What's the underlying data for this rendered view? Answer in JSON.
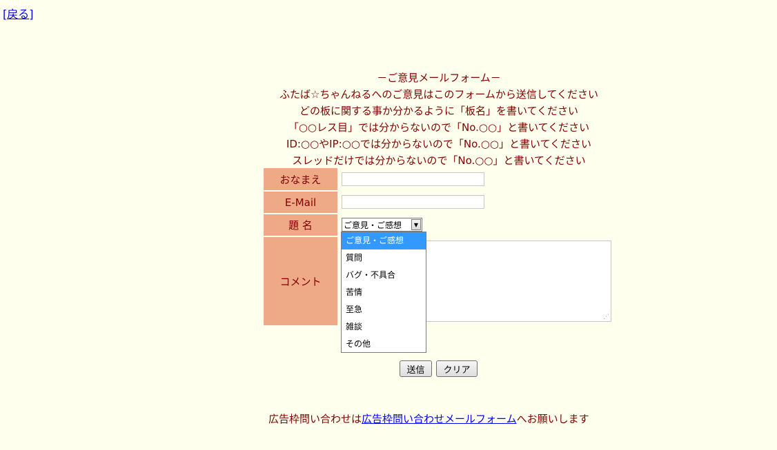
{
  "nav": {
    "back_open": "[",
    "back_label": "戻る",
    "back_close": "]"
  },
  "intro": {
    "title": "－ご意見メールフォーム－",
    "lines": [
      "ふたば☆ちゃんねるへのご意見はこのフォームから送信してください",
      "どの板に関する事か分かるように「板名」を書いてください",
      "「○○レス目」では分からないので「No.○○」と書いてください",
      "ID:○○やIP:○○では分からないので「No.○○」と書いてください",
      "スレッドだけでは分からないので「No.○○」と書いてください"
    ]
  },
  "form": {
    "name_label": "おなまえ",
    "name_value": "",
    "email_label": "E-Mail",
    "email_value": "",
    "subject_label": "題 名",
    "subject_selected": "ご意見・ご感想",
    "subject_options": [
      "ご意見・ご感想",
      "質問",
      "バグ・不具合",
      "苦情",
      "至急",
      "雑談",
      "その他"
    ],
    "comment_label": "コメント",
    "comment_value": "",
    "send_label": "送信",
    "clear_label": "クリア"
  },
  "footer": {
    "text_before": "広告枠問い合わせは",
    "link_label": "広告枠問い合わせメールフォーム",
    "text_after": "へお願いします"
  },
  "colors": {
    "background": "#ffffee",
    "text": "#800000",
    "label_bg": "#eea987",
    "link": "#0000ee",
    "highlight": "#3399ff"
  }
}
